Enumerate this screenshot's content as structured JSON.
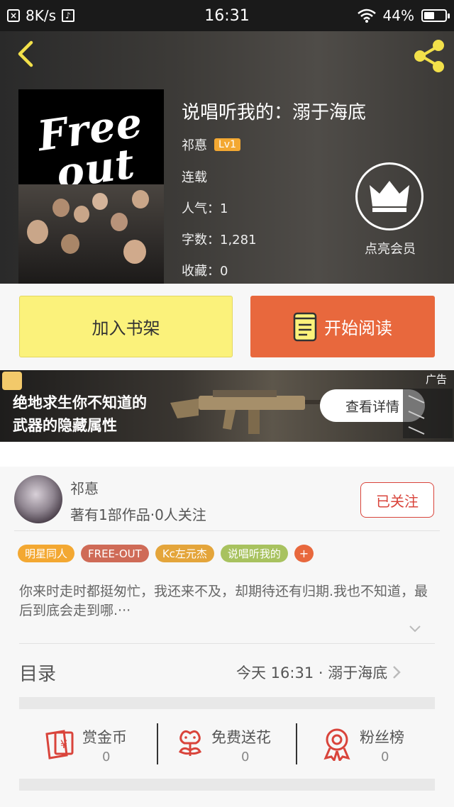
{
  "status_bar": {
    "speed": "8K/s",
    "time": "16:31",
    "battery": "44%"
  },
  "book": {
    "title": "说唱听我的：溺于海底",
    "author": "祁惪",
    "level": "Lv1",
    "status": "连载",
    "popularity": "人气：1",
    "word_count": "字数：1,281",
    "favorites": "收藏：0",
    "cover_art_text": "Free out"
  },
  "vip": {
    "label": "点亮会员"
  },
  "actions": {
    "add_shelf": "加入书架",
    "start_reading": "开始阅读"
  },
  "ad": {
    "line1": "绝地求生你不知道的",
    "line2": "武器的隐藏属性",
    "button": "查看详情",
    "tag": "广告"
  },
  "author_card": {
    "name": "祁惪",
    "stats": "著有1部作品·0人关注",
    "follow": "已关注"
  },
  "tags": [
    {
      "label": "明星同人",
      "color": "#f3a832"
    },
    {
      "label": "FREE-OUT",
      "color": "#cf6b57"
    },
    {
      "label": "Kc左元杰",
      "color": "#e4a53b"
    },
    {
      "label": "说唱听我的",
      "color": "#a8c25f"
    }
  ],
  "tag_add": "+",
  "summary": "你来时走时都挺匆忙，我还来不及，却期待还有归期.我也不知道，最后到底会走到哪.···",
  "toc": {
    "label": "目录",
    "latest": "今天 16:31 · 溺于海底"
  },
  "stats": {
    "coins": {
      "label": "赏金币",
      "value": "0"
    },
    "flowers": {
      "label": "免费送花",
      "value": "0"
    },
    "fans": {
      "label": "粉丝榜",
      "value": "0"
    }
  },
  "colors": {
    "accent_orange": "#e8683d",
    "shelf_yellow": "#fbf27b",
    "follow_red": "#d9443b"
  }
}
